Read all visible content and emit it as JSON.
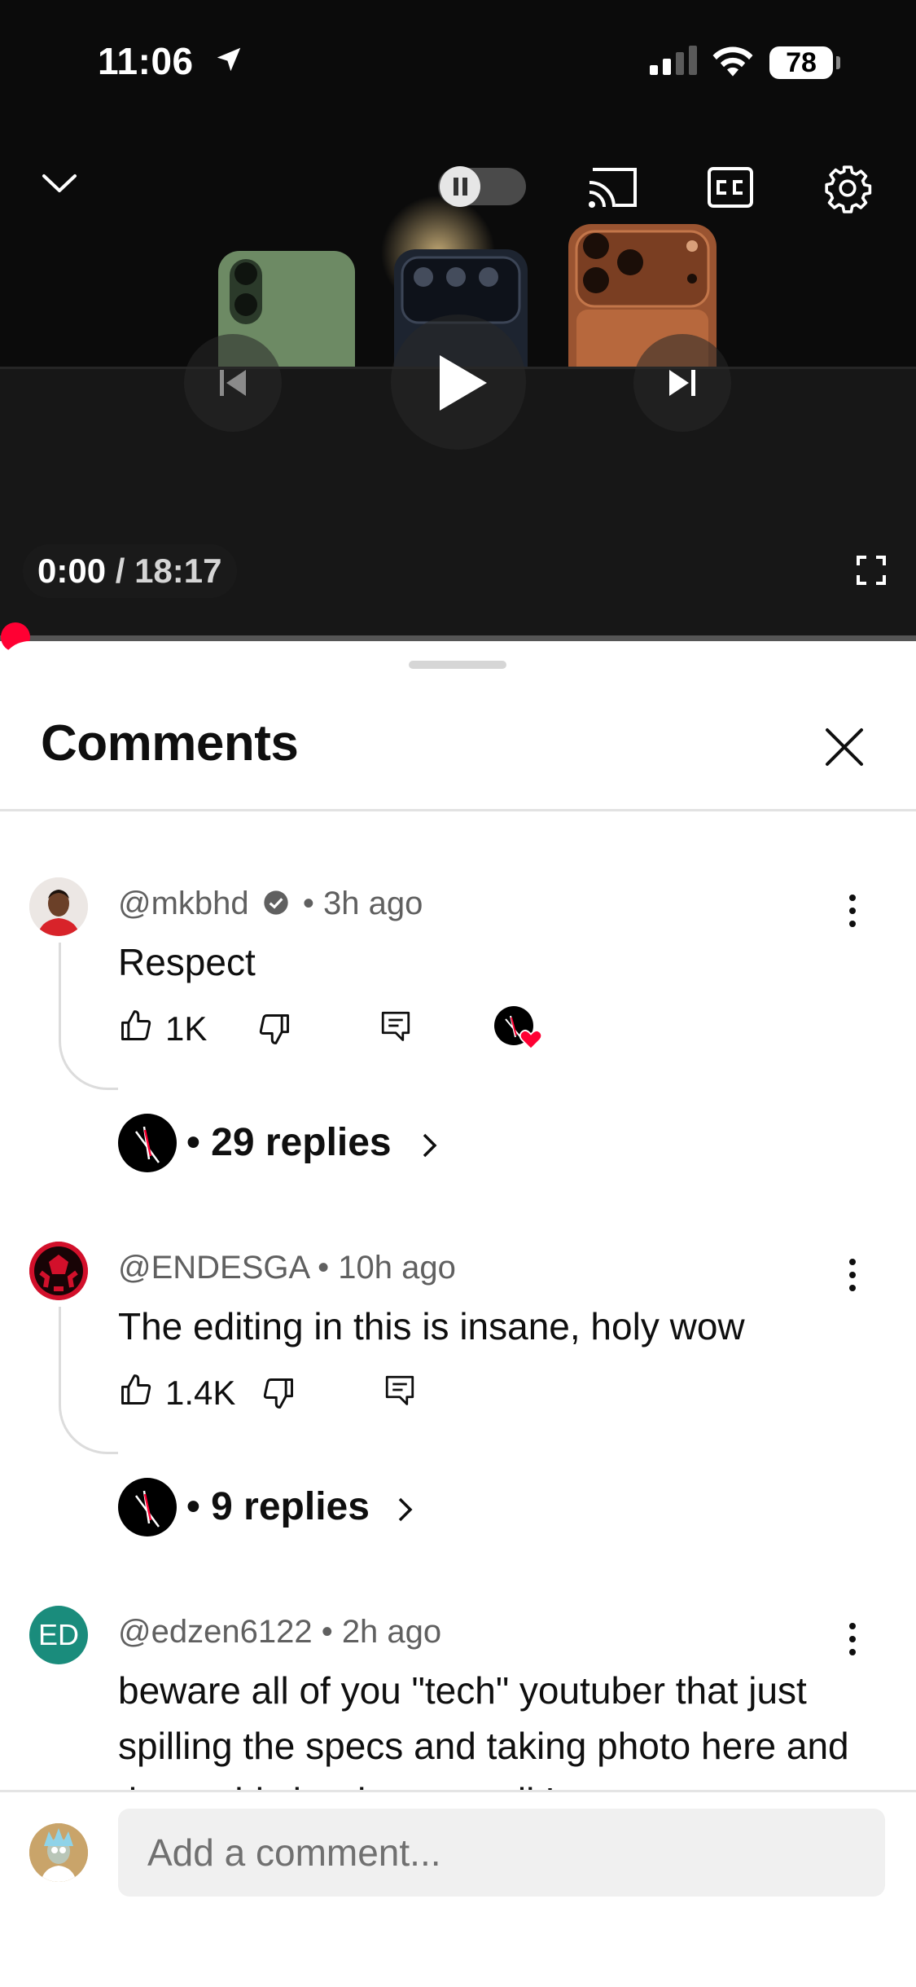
{
  "status_bar": {
    "time": "11:06",
    "battery": "78"
  },
  "player": {
    "current_time": "0:00",
    "separator": " / ",
    "duration": "18:17",
    "progress": 0.0,
    "controls": [
      "collapse-chevron",
      "autoplay-toggle",
      "cast",
      "captions",
      "settings",
      "previous",
      "play",
      "next",
      "fullscreen"
    ]
  },
  "comments_panel": {
    "title": "Comments",
    "comments": [
      {
        "author": "@mkbhd",
        "verified": true,
        "time": "3h ago",
        "text": "Respect",
        "likes": "1K",
        "creator_heart": true,
        "replies": "• 29 replies"
      },
      {
        "author": "@ENDESGA",
        "verified": false,
        "time": "10h ago",
        "text": "The editing in this is insane, holy wow",
        "likes": "1.4K",
        "creator_heart": false,
        "replies": "• 9 replies"
      },
      {
        "author": "@edzen6122",
        "verified": false,
        "time": "2h ago",
        "avatar_initials": "ED",
        "text": "beware all of you \"tech\" youtuber that just spilling the specs and taking photo here and there, this is what we call In"
      }
    ],
    "meta_separator": " • "
  },
  "composer": {
    "placeholder": "Add a comment..."
  },
  "colors": {
    "accent": "#ff0033",
    "teal_avatar": "#1a8c7c",
    "heart": "#ff0033"
  }
}
